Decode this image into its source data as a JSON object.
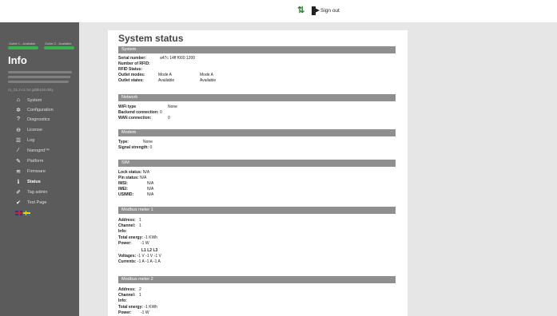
{
  "sidebar": {
    "outlets": [
      "Outlet 1 - Available",
      "Outlet 2 - Available"
    ],
    "info_title": "Info",
    "version": "cs_01.2-c1.54 gd5b128 dirty",
    "nav": [
      {
        "label": "System",
        "icon": "home-icon"
      },
      {
        "label": "Configuration",
        "icon": "gear-icon"
      },
      {
        "label": "Diagnostics",
        "icon": "question-icon"
      },
      {
        "label": "License",
        "icon": "license-icon"
      },
      {
        "label": "Log",
        "icon": "list-icon"
      },
      {
        "label": "Nanogrid™",
        "icon": "nanogrid-icon"
      },
      {
        "label": "Platform",
        "icon": "wrench-icon"
      },
      {
        "label": "Firmware",
        "icon": "wifi-icon"
      },
      {
        "label": "Status",
        "icon": "info-icon",
        "active": true
      },
      {
        "label": "Tag admin",
        "icon": "pencil-icon"
      },
      {
        "label": "Test Page",
        "icon": "check-icon"
      }
    ]
  },
  "topbar": {
    "signout_label": "Sign out"
  },
  "main": {
    "title": "System status",
    "system": {
      "header": "System",
      "serial_label": "Serial number:",
      "serial_value": "a47c 14ff f000 1200",
      "rfid_label": "Number of RFID:",
      "rfid_status_label": "RFID Status:",
      "outlet_modes_label": "Outlet modes:",
      "outlet_modes": [
        "Mode A",
        "Mode A"
      ],
      "outlet_states_label": "Outlet states:",
      "outlet_states": [
        "Available",
        "Available"
      ]
    },
    "network": {
      "header": "Network",
      "wifi_type_label": "WiFi type",
      "wifi_type_value": "None",
      "backend_label": "Backend connection:",
      "backend_value": "0",
      "wan_label": "WAN connection:",
      "wan_value": "0"
    },
    "modem": {
      "header": "Modem",
      "type_label": "Type:",
      "type_value": "None",
      "signal_label": "Signal strength:",
      "signal_value": "0"
    },
    "sim": {
      "header": "SIM",
      "lock_label": "Lock status:",
      "lock_value": "N/A",
      "pin_label": "Pin status:",
      "pin_value": "N/A",
      "imsi_label": "IMSI:",
      "imsi_value": "N/A",
      "imei_label": "IMEI:",
      "imei_value": "N/A",
      "usimid_label": "USIMID:",
      "usimid_value": "N/A"
    },
    "meter1": {
      "header": "Modbus meter 1",
      "address_label": "Address:",
      "address_value": "1",
      "channel_label": "Channel:",
      "channel_value": "1",
      "info_label": "Info:",
      "energy_label": "Total energy:",
      "energy_value": "-1 KWh",
      "power_label": "Power:",
      "power_value": "-1 W",
      "phases": [
        "L1",
        "L2",
        "L3"
      ],
      "voltages_label": "Voltages:",
      "voltages_value": "-1 V -1 V -1 V",
      "currents_label": "Currents:",
      "currents_value": "-1 A -1 A -1 A"
    },
    "meter2": {
      "header": "Modbus meter 2",
      "address_label": "Address:",
      "address_value": "2",
      "channel_label": "Channel:",
      "channel_value": "1",
      "info_label": "Info:",
      "energy_label": "Total energy:",
      "energy_value": "-1 KWh",
      "power_label": "Power:",
      "power_value": "-1 W"
    }
  }
}
